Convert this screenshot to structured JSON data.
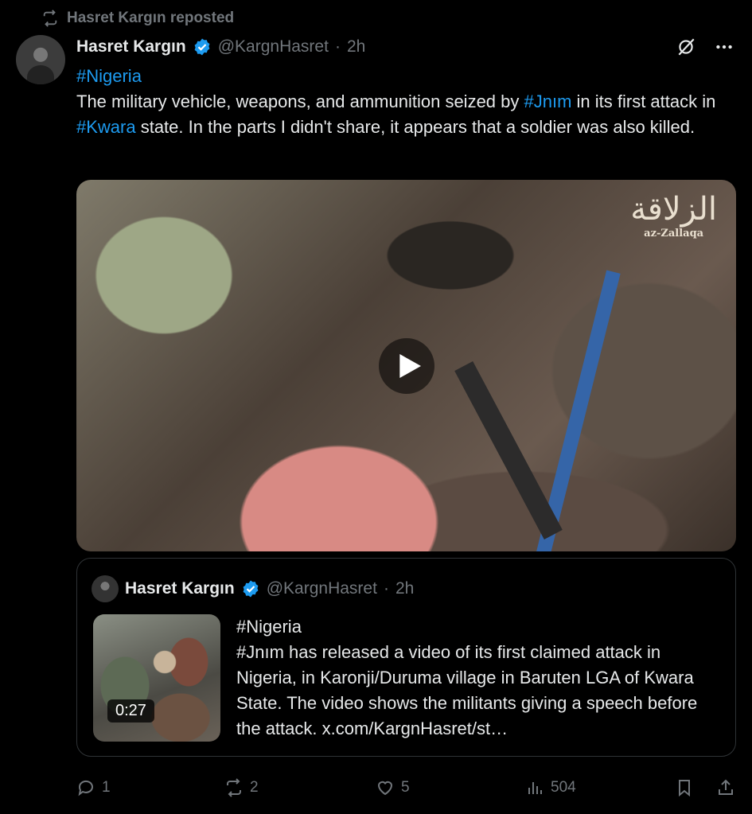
{
  "repost": {
    "text": "Hasret Kargın reposted"
  },
  "tweet": {
    "author_name": "Hasret Kargın",
    "handle": "@KargnHasret",
    "dot": "·",
    "time": "2h",
    "hashtag_line": "#Nigeria",
    "text_part1": "The military vehicle, weapons, and ammunition seized by ",
    "hashtag_jnim": "#Jnım",
    "text_part2": " in its first attack in ",
    "hashtag_kwara": "#Kwara",
    "text_part3": " state. In the parts I didn't share, it appears that a soldier was also killed."
  },
  "media": {
    "watermark_glyph": "الزلاقة",
    "watermark_text": "az-Zallaqa",
    "play_icon": "play-icon"
  },
  "quote": {
    "author_name": "Hasret Kargın",
    "handle": "@KargnHasret",
    "dot": "·",
    "time": "2h",
    "duration": "0:27",
    "line1": "#Nigeria",
    "line2": "#Jnım has released a video of its first claimed attack in Nigeria, in Karonji/Duruma village in Baruten LGA of Kwara State. The video shows the militants giving a speech before the attack.  x.com/KargnHasret/st…"
  },
  "actions": {
    "replies": "1",
    "reposts": "2",
    "likes": "5",
    "views": "504"
  },
  "colors": {
    "link": "#1d9bf0",
    "muted": "#71767b",
    "verified": "#1d9bf0"
  }
}
